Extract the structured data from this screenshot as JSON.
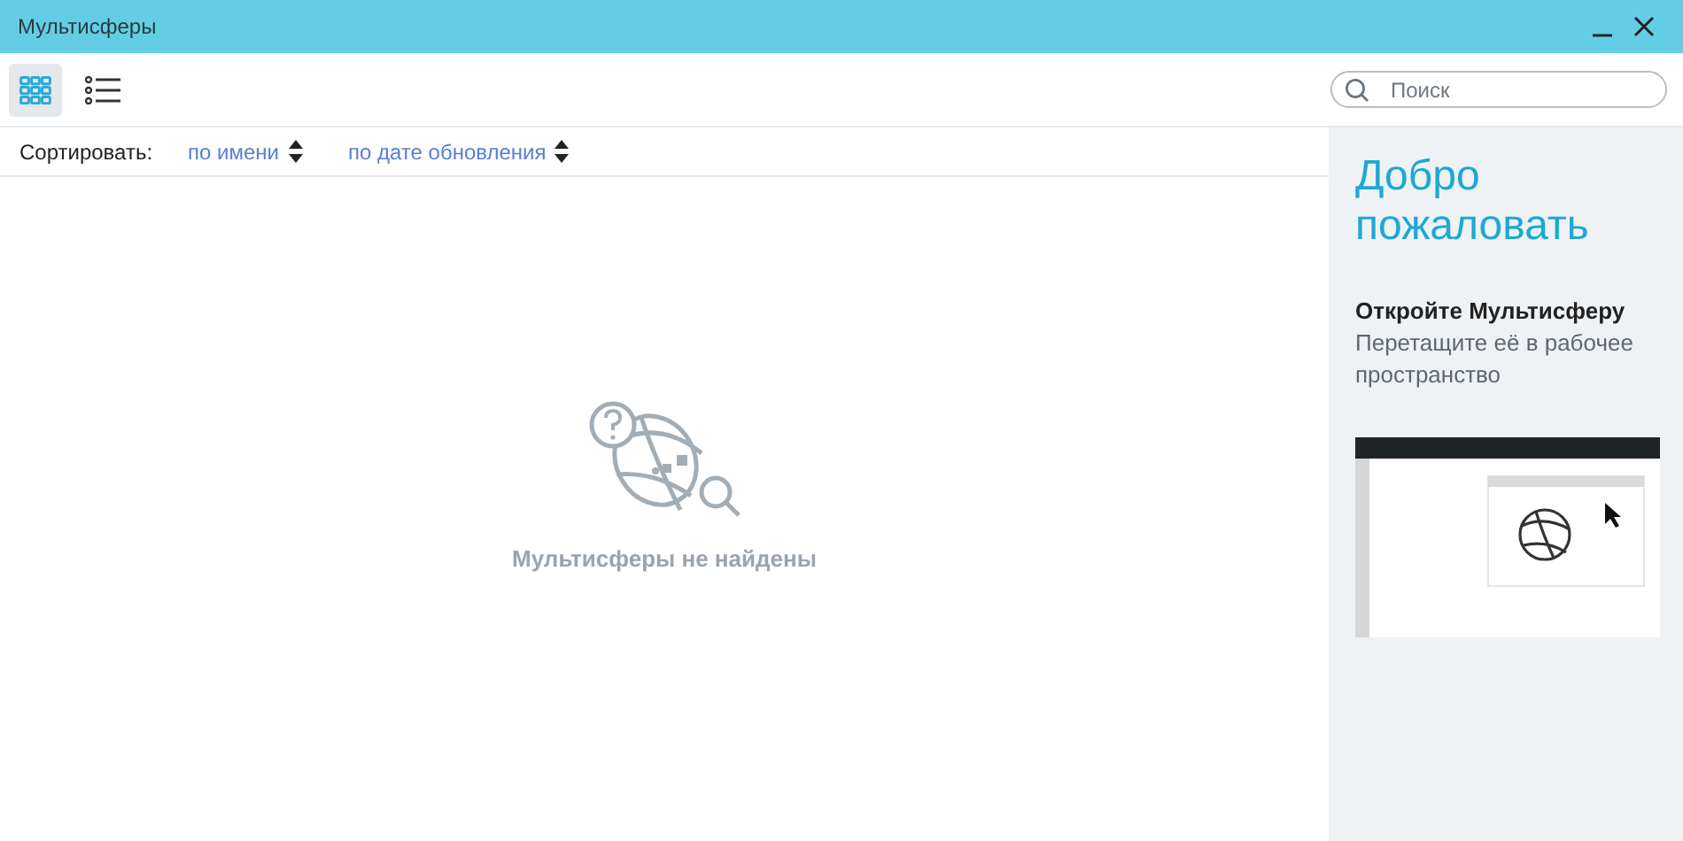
{
  "window": {
    "title": "Мультисферы"
  },
  "view_modes": [
    {
      "kind": "grid",
      "selected": true
    },
    {
      "kind": "list",
      "selected": false
    }
  ],
  "search": {
    "placeholder": "Поиск"
  },
  "sort": {
    "label": "Сортировать:",
    "options": [
      {
        "label": "по имени"
      },
      {
        "label": "по дате обновления"
      }
    ]
  },
  "empty_state": {
    "message": "Мультисферы не найдены"
  },
  "welcome": {
    "title": "Добро пожаловать",
    "heading": "Откройте Мультисферу",
    "text": "Перетащите её в рабочее пространство"
  }
}
